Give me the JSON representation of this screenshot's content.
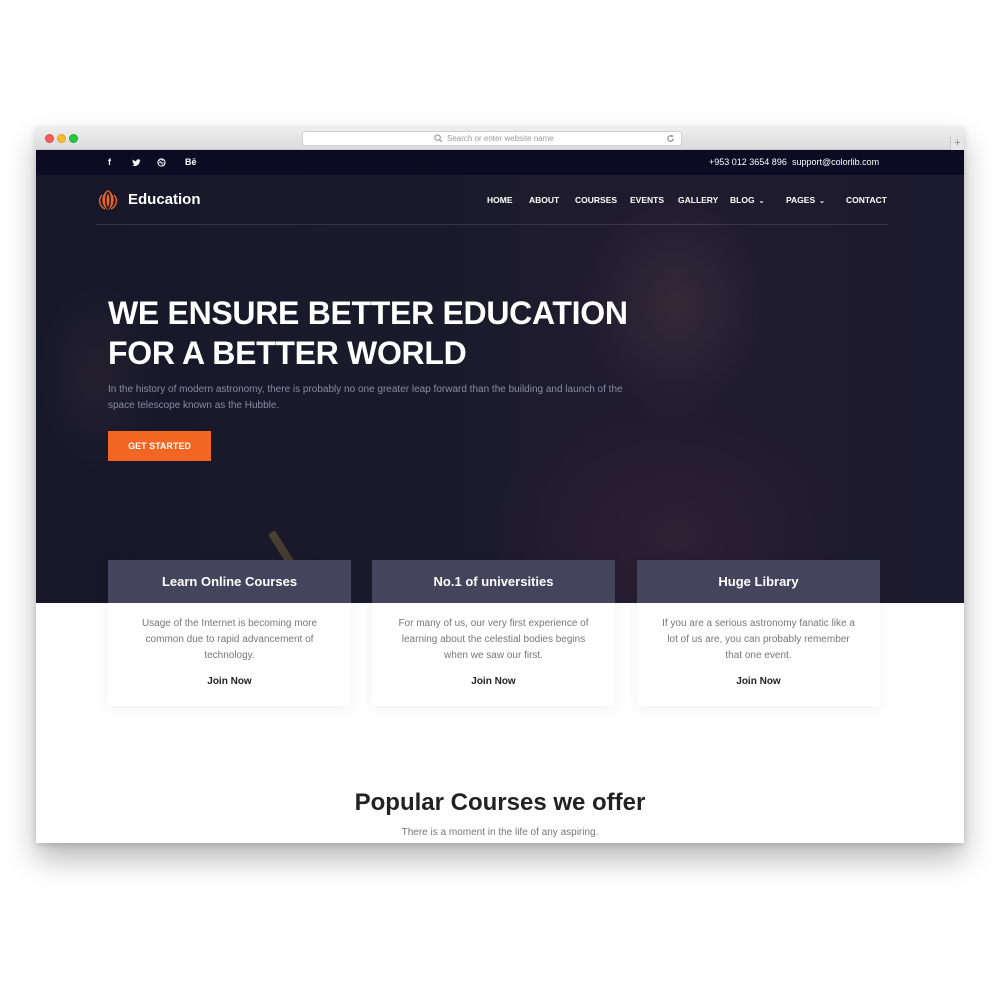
{
  "browser": {
    "url_placeholder": "Search or enter website name",
    "new_tab": "+"
  },
  "topbar": {
    "social": [
      "f",
      "t",
      "dribbble-icon",
      "Bē"
    ],
    "phone": "+953 012 3654 896",
    "email": "support@colorlib.com"
  },
  "header": {
    "brand": "Education",
    "nav": [
      {
        "label": "HOME"
      },
      {
        "label": "ABOUT"
      },
      {
        "label": "COURSES"
      },
      {
        "label": "EVENTS"
      },
      {
        "label": "GALLERY"
      },
      {
        "label": "BLOG",
        "caret": "⌄"
      },
      {
        "label": "PAGES",
        "caret": "⌄"
      },
      {
        "label": "CONTACT"
      }
    ]
  },
  "hero": {
    "headline_line1": "WE ENSURE BETTER EDUCATION",
    "headline_line2": "FOR A BETTER WORLD",
    "subtext_line1": "In the history of modern astronomy, there is probably no one greater leap forward than the building and launch of the",
    "subtext_line2": "space telescope known as the Hubble.",
    "cta": "GET STARTED"
  },
  "features": [
    {
      "title": "Learn Online Courses",
      "lines": [
        "Usage of the Internet is becoming more",
        "common due to rapid advancement of",
        "technology."
      ],
      "link": "Join Now"
    },
    {
      "title": "No.1 of universities",
      "lines": [
        "For many of us, our very first experience of",
        "learning about the celestial bodies begins",
        "when we saw our first."
      ],
      "link": "Join Now"
    },
    {
      "title": "Huge Library",
      "lines": [
        "If you are a serious astronomy fanatic like a",
        "lot of us are, you can probably remember",
        "that one event."
      ],
      "link": "Join Now"
    }
  ],
  "courses": {
    "title": "Popular Courses we offer",
    "subtitle": "There is a moment in the life of any aspiring."
  },
  "colors": {
    "accent": "#f26522",
    "topbar_bg": "#0b0b24",
    "card_header_bg": "#34344e"
  }
}
